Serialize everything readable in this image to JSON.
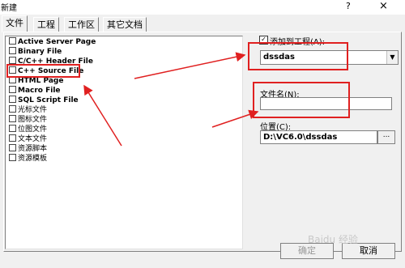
{
  "window": {
    "title": "新建",
    "help": "?",
    "close": "×"
  },
  "tabs": [
    {
      "label": "文件"
    },
    {
      "label": "工程"
    },
    {
      "label": "工作区"
    },
    {
      "label": "其它文档"
    }
  ],
  "file_types": [
    {
      "label": "Active Server Page"
    },
    {
      "label": "Binary File"
    },
    {
      "label": "C/C++ Header File"
    },
    {
      "label": "C++ Source File"
    },
    {
      "label": "HTML Page"
    },
    {
      "label": "Macro File"
    },
    {
      "label": "SQL Script File"
    },
    {
      "label": "光标文件"
    },
    {
      "label": "图标文件"
    },
    {
      "label": "位图文件"
    },
    {
      "label": "文本文件"
    },
    {
      "label": "资源脚本"
    },
    {
      "label": "资源模板"
    }
  ],
  "add_to_project": {
    "label": "添加到工程(A):",
    "checked": true
  },
  "project_combo": {
    "value": "dssdas"
  },
  "file_name": {
    "label": "文件名(N):",
    "value": ""
  },
  "location": {
    "label": "位置(C):",
    "value": "D:\\VC6.0\\dssdas",
    "browse_label": "..."
  },
  "buttons": {
    "ok": "确定",
    "cancel": "取消"
  },
  "watermark": "Baidu 经验",
  "colors": {
    "annotation": "#e02020"
  }
}
